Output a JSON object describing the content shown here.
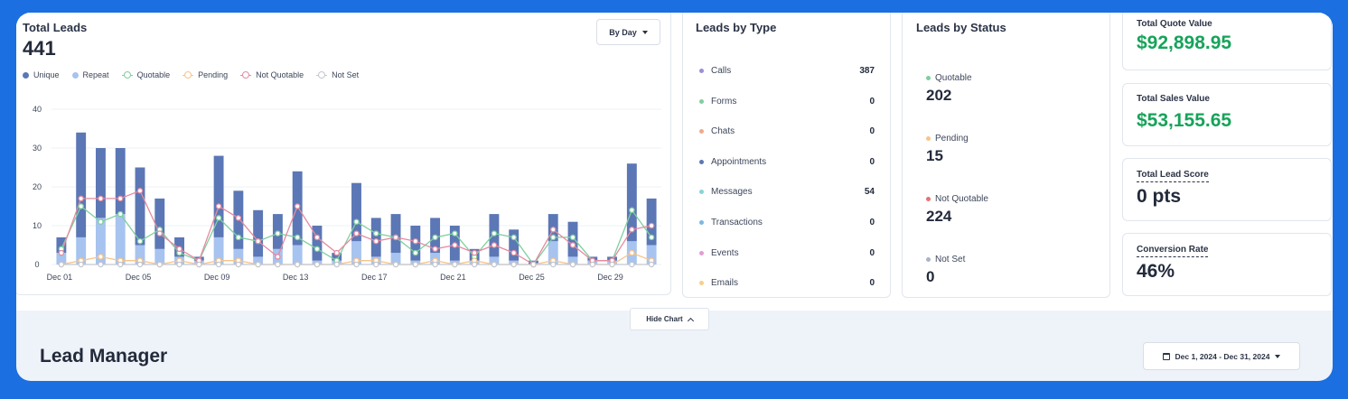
{
  "total_leads": {
    "title": "Total Leads",
    "count": "441",
    "period_button": "By Day",
    "legend": [
      {
        "label": "Unique",
        "color": "#5b77b5",
        "style": "dot"
      },
      {
        "label": "Repeat",
        "color": "#a7c3ef",
        "style": "dot"
      },
      {
        "label": "Quotable",
        "color": "#7fcf9f",
        "style": "ring"
      },
      {
        "label": "Pending",
        "color": "#f7c48a",
        "style": "ring"
      },
      {
        "label": "Not Quotable",
        "color": "#e58aa0",
        "style": "ring"
      },
      {
        "label": "Not Set",
        "color": "#c2c7cf",
        "style": "ring"
      }
    ]
  },
  "chart_data": {
    "type": "bar",
    "title": "",
    "xlabel": "",
    "ylabel": "",
    "ylim": [
      0,
      40
    ],
    "yticks": [
      0,
      10,
      20,
      30,
      40
    ],
    "x_tick_labels": [
      "Dec 01",
      "Dec 05",
      "Dec 09",
      "Dec 13",
      "Dec 17",
      "Dec 21",
      "Dec 25",
      "Dec 29"
    ],
    "x_tick_indices": [
      0,
      4,
      8,
      12,
      16,
      20,
      24,
      28
    ],
    "categories": [
      "Dec 01",
      "Dec 02",
      "Dec 03",
      "Dec 04",
      "Dec 05",
      "Dec 06",
      "Dec 07",
      "Dec 08",
      "Dec 09",
      "Dec 10",
      "Dec 11",
      "Dec 12",
      "Dec 13",
      "Dec 14",
      "Dec 15",
      "Dec 16",
      "Dec 17",
      "Dec 18",
      "Dec 19",
      "Dec 20",
      "Dec 21",
      "Dec 22",
      "Dec 23",
      "Dec 24",
      "Dec 25",
      "Dec 26",
      "Dec 27",
      "Dec 28",
      "Dec 29",
      "Dec 30",
      "Dec 31"
    ],
    "stacked": true,
    "series": [
      {
        "name": "Unique",
        "kind": "bar",
        "color": "#5b77b5",
        "values": [
          4,
          27,
          18,
          17,
          20,
          13,
          5,
          1,
          21,
          15,
          12,
          9,
          19,
          9,
          2,
          15,
          10,
          10,
          9,
          9,
          9,
          3,
          11,
          8,
          1,
          7,
          9,
          1,
          1,
          20,
          12
        ]
      },
      {
        "name": "Repeat",
        "kind": "bar",
        "color": "#a7c3ef",
        "values": [
          3,
          7,
          12,
          13,
          5,
          4,
          2,
          1,
          7,
          4,
          2,
          4,
          5,
          1,
          1,
          6,
          2,
          3,
          1,
          3,
          1,
          1,
          2,
          1,
          0,
          6,
          2,
          1,
          1,
          6,
          5
        ]
      },
      {
        "name": "Quotable",
        "kind": "line",
        "color": "#7fcf9f",
        "values": [
          4,
          15,
          11,
          13,
          6,
          9,
          3,
          1,
          12,
          7,
          6,
          8,
          7,
          4,
          1,
          11,
          8,
          7,
          3,
          7,
          8,
          2,
          8,
          7,
          0,
          7,
          7,
          1,
          1,
          14,
          7
        ]
      },
      {
        "name": "Pending",
        "kind": "line",
        "color": "#f7c48a",
        "values": [
          0,
          1,
          2,
          1,
          1,
          0,
          1,
          0,
          1,
          1,
          0,
          0,
          0,
          0,
          0,
          1,
          1,
          0,
          0,
          1,
          0,
          1,
          0,
          0,
          0,
          1,
          0,
          0,
          0,
          3,
          1
        ]
      },
      {
        "name": "Not Quotable",
        "kind": "line",
        "color": "#e58aa0",
        "values": [
          3,
          17,
          17,
          17,
          19,
          8,
          4,
          1,
          15,
          12,
          6,
          2,
          15,
          7,
          3,
          8,
          6,
          7,
          6,
          4,
          5,
          3,
          5,
          3,
          0,
          9,
          5,
          1,
          1,
          9,
          10
        ]
      },
      {
        "name": "Not Set",
        "kind": "line",
        "color": "#c2c7cf",
        "values": [
          0,
          0,
          0,
          0,
          0,
          0,
          0,
          0,
          0,
          0,
          0,
          0,
          0,
          0,
          0,
          0,
          0,
          0,
          0,
          0,
          0,
          0,
          0,
          0,
          0,
          0,
          0,
          0,
          0,
          0,
          0
        ]
      }
    ],
    "grid": true,
    "legend_position": "top-left"
  },
  "leads_by_type": {
    "title": "Leads by Type",
    "items": [
      {
        "label": "Calls",
        "value": "387",
        "color": "#9b8fd6"
      },
      {
        "label": "Forms",
        "value": "0",
        "color": "#7fcf9f"
      },
      {
        "label": "Chats",
        "value": "0",
        "color": "#f2a98a"
      },
      {
        "label": "Appointments",
        "value": "0",
        "color": "#5b77b5"
      },
      {
        "label": "Messages",
        "value": "54",
        "color": "#86d4d9"
      },
      {
        "label": "Transactions",
        "value": "0",
        "color": "#7bb8e0"
      },
      {
        "label": "Events",
        "value": "0",
        "color": "#e59bd6"
      },
      {
        "label": "Emails",
        "value": "0",
        "color": "#f5d08a"
      }
    ]
  },
  "leads_by_status": {
    "title": "Leads by Status",
    "items": [
      {
        "label": "Quotable",
        "value": "202",
        "color": "#7fcf9f"
      },
      {
        "label": "Pending",
        "value": "15",
        "color": "#f7c48a"
      },
      {
        "label": "Not Quotable",
        "value": "224",
        "color": "#e57373"
      },
      {
        "label": "Not Set",
        "value": "0",
        "color": "#a9b4c4"
      }
    ]
  },
  "kpis": {
    "quote_title": "Total Quote Value",
    "quote_value": "$92,898.95",
    "sales_title": "Total Sales Value",
    "sales_value": "$53,155.65",
    "score_title": "Total Lead Score",
    "score_value": "0 pts",
    "conversion_title": "Conversion Rate",
    "conversion_value": "46%"
  },
  "hide_chart_label": "Hide Chart",
  "lead_manager_title": "Lead Manager",
  "date_range": "Dec 1, 2024 - Dec 31, 2024"
}
